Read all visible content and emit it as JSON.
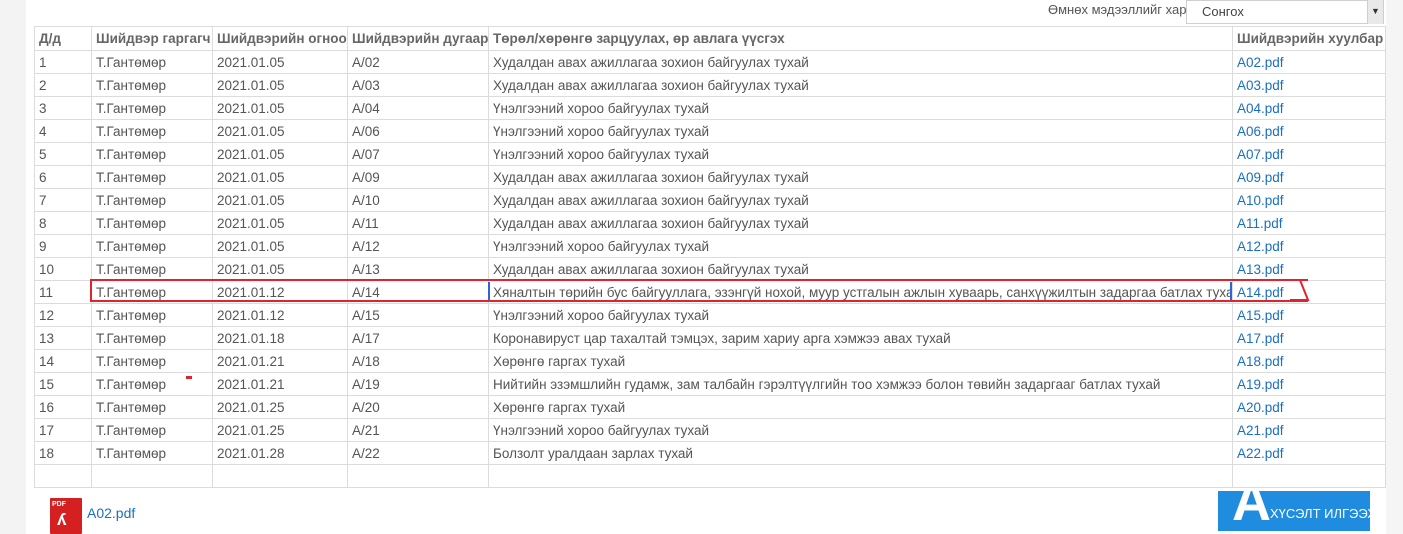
{
  "filter": {
    "label": "Өмнөх мэдээллийг харах",
    "selected": "Сонгох"
  },
  "table": {
    "headers": [
      "Д/д",
      "Шийдвэр гаргагч",
      "Шийдвэрийн огноо",
      "Шийдвэрийн дугаар",
      "Төрөл/хөрөнгө зарцуулах, өр авлага үүсгэх",
      "Шийдвэрийн хуулбар"
    ],
    "rows": [
      {
        "no": "1",
        "author": "Т.Гантөмөр",
        "date": "2021.01.05",
        "number": "A/02",
        "subject": "Худалдан авах ажиллагаа зохион байгуулах тухай",
        "file": "A02.pdf"
      },
      {
        "no": "2",
        "author": "Т.Гантөмөр",
        "date": "2021.01.05",
        "number": "A/03",
        "subject": "Худалдан авах ажиллагаа зохион байгуулах тухай",
        "file": "A03.pdf"
      },
      {
        "no": "3",
        "author": "Т.Гантөмөр",
        "date": "2021.01.05",
        "number": "A/04",
        "subject": "Үнэлгээний хороо байгуулах тухай",
        "file": "A04.pdf"
      },
      {
        "no": "4",
        "author": "Т.Гантөмөр",
        "date": "2021.01.05",
        "number": "A/06",
        "subject": "Үнэлгээний хороо байгуулах тухай",
        "file": "A06.pdf"
      },
      {
        "no": "5",
        "author": "Т.Гантөмөр",
        "date": "2021.01.05",
        "number": "A/07",
        "subject": "Үнэлгээний хороо байгуулах тухай",
        "file": "A07.pdf"
      },
      {
        "no": "6",
        "author": "Т.Гантөмөр",
        "date": "2021.01.05",
        "number": "A/09",
        "subject": "Худалдан авах ажиллагаа зохион байгуулах тухай",
        "file": "A09.pdf"
      },
      {
        "no": "7",
        "author": "Т.Гантөмөр",
        "date": "2021.01.05",
        "number": "A/10",
        "subject": "Худалдан авах ажиллагаа зохион байгуулах тухай",
        "file": "A10.pdf"
      },
      {
        "no": "8",
        "author": "Т.Гантөмөр",
        "date": "2021.01.05",
        "number": "A/11",
        "subject": "Худалдан авах ажиллагаа зохион байгуулах тухай",
        "file": "A11.pdf"
      },
      {
        "no": "9",
        "author": "Т.Гантөмөр",
        "date": "2021.01.05",
        "number": "A/12",
        "subject": "Үнэлгээний хороо байгуулах тухай",
        "file": "A12.pdf"
      },
      {
        "no": "10",
        "author": "Т.Гантөмөр",
        "date": "2021.01.05",
        "number": "A/13",
        "subject": "Худалдан авах ажиллагаа зохион байгуулах тухай",
        "file": "A13.pdf"
      },
      {
        "no": "11",
        "author": "Т.Гантөмөр",
        "date": "2021.01.12",
        "number": "A/14",
        "subject": "Хяналтын төрийн бус байгууллага, эзэнгүй нохой, муур устгалын ажлын хуваарь, санхүүжилтын задаргаа батлах тухай",
        "file": "A14.pdf"
      },
      {
        "no": "12",
        "author": "Т.Гантөмөр",
        "date": "2021.01.12",
        "number": "A/15",
        "subject": "Үнэлгээний хороо байгуулах тухай",
        "file": "A15.pdf"
      },
      {
        "no": "13",
        "author": "Т.Гантөмөр",
        "date": "2021.01.18",
        "number": "A/17",
        "subject": "Коронавируст цар тахалтай тэмцэх, зарим хариу арга хэмжээ авах тухай",
        "file": "A17.pdf"
      },
      {
        "no": "14",
        "author": "Т.Гантөмөр",
        "date": "2021.01.21",
        "number": "A/18",
        "subject": "Хөрөнгө гаргах тухай",
        "file": "A18.pdf"
      },
      {
        "no": "15",
        "author": "Т.Гантөмөр",
        "date": "2021.01.21",
        "number": "A/19",
        "subject": "Нийтийн эзэмшлийн гудамж, зам талбайн гэрэлтүүлгийн тоо хэмжээ болон төвийн задаргааг батлах тухай",
        "file": "A19.pdf"
      },
      {
        "no": "16",
        "author": "Т.Гантөмөр",
        "date": "2021.01.25",
        "number": "A/20",
        "subject": "Хөрөнгө гаргах тухай",
        "file": "A20.pdf"
      },
      {
        "no": "17",
        "author": "Т.Гантөмөр",
        "date": "2021.01.25",
        "number": "A/21",
        "subject": "Үнэлгээний хороо байгуулах тухай",
        "file": "A21.pdf"
      },
      {
        "no": "18",
        "author": "Т.Гантөмөр",
        "date": "2021.01.28",
        "number": "A/22",
        "subject": "Болзолт уралдаан зарлах тухай",
        "file": "A22.pdf"
      }
    ]
  },
  "attachment": {
    "icon_tag": "PDF",
    "name": "A02.pdf"
  },
  "submit": {
    "big_letter": "A",
    "label": "ХҮСЭЛТ ИЛГЭЭХ"
  },
  "colors": {
    "link": "#1a6fc4",
    "highlight": "#e2222c",
    "button": "#1f8ce0"
  }
}
